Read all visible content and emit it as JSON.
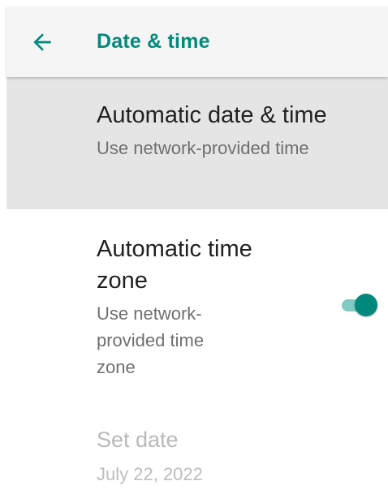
{
  "header": {
    "title": "Date & time",
    "back_icon": "arrow-back-icon",
    "accent_color": "#00897b"
  },
  "settings": {
    "automatic_date_time": {
      "title": "Automatic date & time",
      "summary": "Use network-provided time"
    },
    "automatic_time_zone": {
      "title": "Automatic time zone",
      "summary": "Use network-provided time zone",
      "toggle_state": "on"
    },
    "set_date": {
      "title": "Set date",
      "summary": "July 22, 2022"
    }
  }
}
